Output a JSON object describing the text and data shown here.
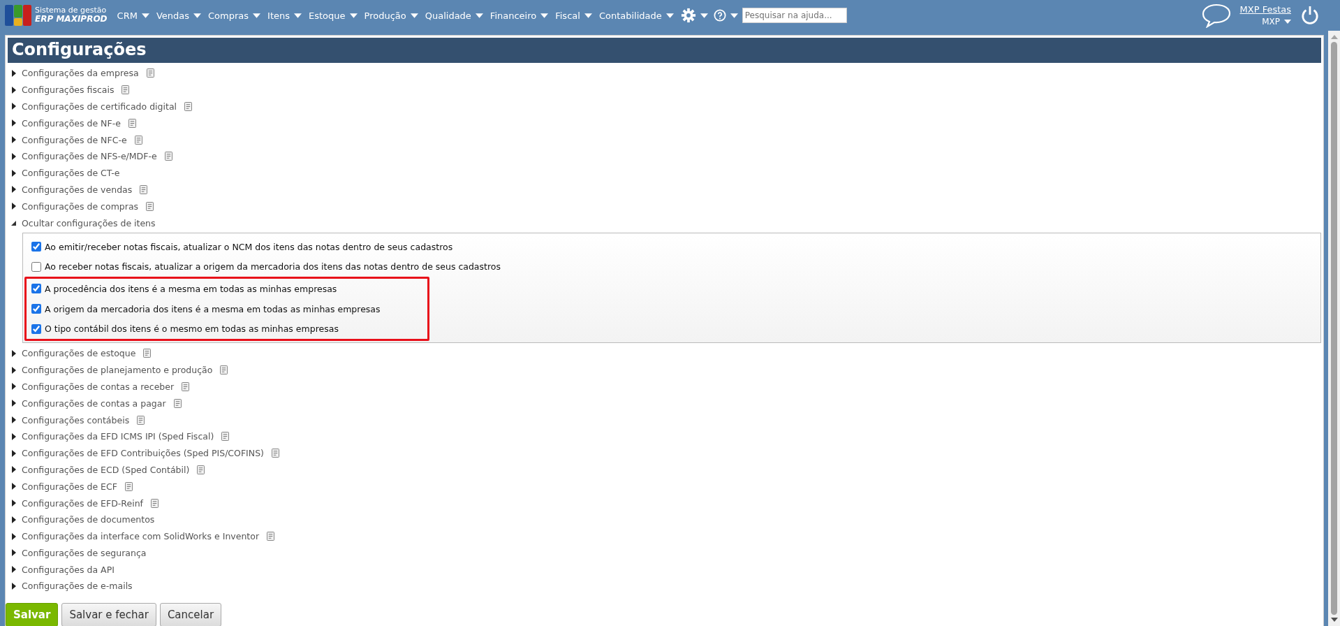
{
  "brand": {
    "line1": "Sistema de gestão",
    "line2": "ERP MAXIPROD"
  },
  "menu": [
    {
      "label": "CRM"
    },
    {
      "label": "Vendas"
    },
    {
      "label": "Compras"
    },
    {
      "label": "Itens"
    },
    {
      "label": "Estoque"
    },
    {
      "label": "Produção"
    },
    {
      "label": "Qualidade"
    },
    {
      "label": "Financeiro"
    },
    {
      "label": "Fiscal"
    },
    {
      "label": "Contabilidade"
    }
  ],
  "help_search": {
    "placeholder": "Pesquisar na ajuda..."
  },
  "user": {
    "company": "MXP Festas",
    "account": "MXP"
  },
  "page_title": "Configurações",
  "sections": [
    {
      "label": "Configurações da empresa",
      "expanded": false,
      "has_doc": true
    },
    {
      "label": "Configurações fiscais",
      "expanded": false,
      "has_doc": true
    },
    {
      "label": "Configurações de certificado digital",
      "expanded": false,
      "has_doc": true
    },
    {
      "label": "Configurações de NF-e",
      "expanded": false,
      "has_doc": true
    },
    {
      "label": "Configurações de NFC-e",
      "expanded": false,
      "has_doc": true
    },
    {
      "label": "Configurações de NFS-e/MDF-e",
      "expanded": false,
      "has_doc": true
    },
    {
      "label": "Configurações de CT-e",
      "expanded": false,
      "has_doc": false
    },
    {
      "label": "Configurações de vendas",
      "expanded": false,
      "has_doc": true
    },
    {
      "label": "Configurações de compras",
      "expanded": false,
      "has_doc": true
    },
    {
      "label": "Ocultar configurações de itens",
      "expanded": true,
      "has_doc": false,
      "groups": [
        {
          "highlighted": false,
          "options": [
            {
              "label": "Ao emitir/receber notas fiscais, atualizar o NCM dos itens das notas dentro de seus cadastros",
              "checked": true
            },
            {
              "label": "Ao receber notas fiscais, atualizar a origem da mercadoria dos itens das notas dentro de seus cadastros",
              "checked": false
            }
          ]
        },
        {
          "highlighted": true,
          "options": [
            {
              "label": "A procedência dos itens é a mesma em todas as minhas empresas",
              "checked": true
            },
            {
              "label": "A origem da mercadoria dos itens é a mesma em todas as minhas empresas",
              "checked": true
            },
            {
              "label": "O tipo contábil dos itens é o mesmo em todas as minhas empresas",
              "checked": true
            }
          ]
        }
      ]
    },
    {
      "label": "Configurações de estoque",
      "expanded": false,
      "has_doc": true
    },
    {
      "label": "Configurações de planejamento e produção",
      "expanded": false,
      "has_doc": true
    },
    {
      "label": "Configurações de contas a receber",
      "expanded": false,
      "has_doc": true
    },
    {
      "label": "Configurações de contas a pagar",
      "expanded": false,
      "has_doc": true
    },
    {
      "label": "Configurações contábeis",
      "expanded": false,
      "has_doc": true
    },
    {
      "label": "Configurações da EFD ICMS IPI (Sped Fiscal)",
      "expanded": false,
      "has_doc": true
    },
    {
      "label": "Configurações de EFD Contribuições (Sped PIS/COFINS)",
      "expanded": false,
      "has_doc": true
    },
    {
      "label": "Configurações de ECD (Sped Contábil)",
      "expanded": false,
      "has_doc": true
    },
    {
      "label": "Configurações de ECF",
      "expanded": false,
      "has_doc": true
    },
    {
      "label": "Configurações de EFD-Reinf",
      "expanded": false,
      "has_doc": true
    },
    {
      "label": "Configurações de documentos",
      "expanded": false,
      "has_doc": false
    },
    {
      "label": "Configurações da interface com SolidWorks e Inventor",
      "expanded": false,
      "has_doc": true
    },
    {
      "label": "Configurações de segurança",
      "expanded": false,
      "has_doc": false
    },
    {
      "label": "Configurações da API",
      "expanded": false,
      "has_doc": false
    },
    {
      "label": "Configurações de e-mails",
      "expanded": false,
      "has_doc": false
    }
  ],
  "buttons": [
    {
      "label": "Salvar",
      "kind": "primary"
    },
    {
      "label": "Salvar e fechar",
      "kind": "secondary"
    },
    {
      "label": "Cancelar",
      "kind": "secondary"
    }
  ]
}
